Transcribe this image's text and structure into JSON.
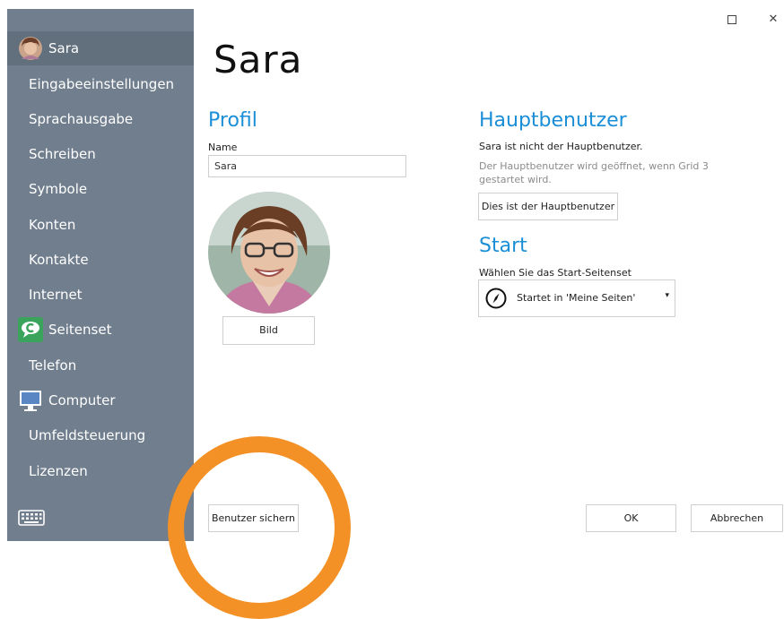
{
  "window": {
    "maximize_symbol": "□",
    "close_symbol": "✕"
  },
  "sidebar": {
    "items": [
      {
        "label": "Sara",
        "icon": "user-avatar-icon"
      },
      {
        "label": "Eingabeeinstellungen"
      },
      {
        "label": "Sprachausgabe"
      },
      {
        "label": "Schreiben"
      },
      {
        "label": "Symbole"
      },
      {
        "label": "Konten"
      },
      {
        "label": "Kontakte"
      },
      {
        "label": "Internet"
      },
      {
        "label": "Seitenset",
        "icon": "speech-bubble-icon"
      },
      {
        "label": "Telefon"
      },
      {
        "label": "Computer",
        "icon": "monitor-icon"
      },
      {
        "label": "Umfeldsteuerung"
      },
      {
        "label": "Lizenzen"
      }
    ],
    "keyboard_icon": "keyboard-icon"
  },
  "page": {
    "title": "Sara"
  },
  "profile": {
    "heading": "Profil",
    "name_label": "Name",
    "name_value": "Sara",
    "picture_button": "Bild"
  },
  "main_user": {
    "heading": "Hauptbenutzer",
    "status": "Sara ist nicht der Hauptbenutzer.",
    "hint": "Der Hauptbenutzer wird geöffnet, wenn Grid 3 gestartet wird.",
    "button": "Dies ist der Hauptbenutzer"
  },
  "start": {
    "heading": "Start",
    "label": "Wählen Sie das Start-Seitenset",
    "selected": "Startet in 'Meine Seiten'",
    "icon": "compass-icon"
  },
  "footer": {
    "backup_button": "Benutzer sichern",
    "ok_button": "OK",
    "cancel_button": "Abbrechen"
  },
  "colors": {
    "sidebar_bg": "#707e8e",
    "sidebar_active": "#62707e",
    "accent_blue": "#1a8ed6",
    "highlight_orange": "#f39126"
  }
}
